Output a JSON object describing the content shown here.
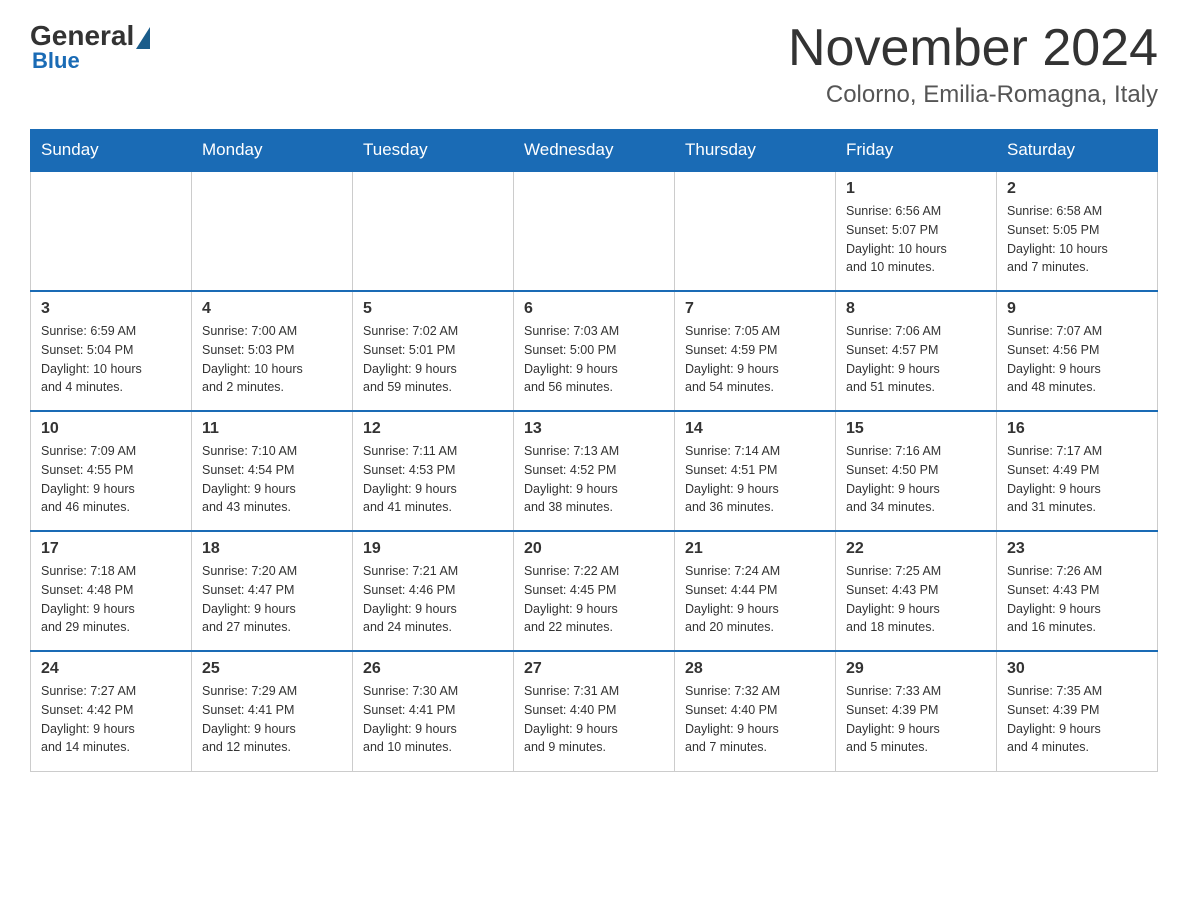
{
  "logo": {
    "general": "General",
    "blue": "Blue"
  },
  "title": "November 2024",
  "location": "Colorno, Emilia-Romagna, Italy",
  "days_of_week": [
    "Sunday",
    "Monday",
    "Tuesday",
    "Wednesday",
    "Thursday",
    "Friday",
    "Saturday"
  ],
  "weeks": [
    [
      {
        "day": "",
        "info": ""
      },
      {
        "day": "",
        "info": ""
      },
      {
        "day": "",
        "info": ""
      },
      {
        "day": "",
        "info": ""
      },
      {
        "day": "",
        "info": ""
      },
      {
        "day": "1",
        "info": "Sunrise: 6:56 AM\nSunset: 5:07 PM\nDaylight: 10 hours\nand 10 minutes."
      },
      {
        "day": "2",
        "info": "Sunrise: 6:58 AM\nSunset: 5:05 PM\nDaylight: 10 hours\nand 7 minutes."
      }
    ],
    [
      {
        "day": "3",
        "info": "Sunrise: 6:59 AM\nSunset: 5:04 PM\nDaylight: 10 hours\nand 4 minutes."
      },
      {
        "day": "4",
        "info": "Sunrise: 7:00 AM\nSunset: 5:03 PM\nDaylight: 10 hours\nand 2 minutes."
      },
      {
        "day": "5",
        "info": "Sunrise: 7:02 AM\nSunset: 5:01 PM\nDaylight: 9 hours\nand 59 minutes."
      },
      {
        "day": "6",
        "info": "Sunrise: 7:03 AM\nSunset: 5:00 PM\nDaylight: 9 hours\nand 56 minutes."
      },
      {
        "day": "7",
        "info": "Sunrise: 7:05 AM\nSunset: 4:59 PM\nDaylight: 9 hours\nand 54 minutes."
      },
      {
        "day": "8",
        "info": "Sunrise: 7:06 AM\nSunset: 4:57 PM\nDaylight: 9 hours\nand 51 minutes."
      },
      {
        "day": "9",
        "info": "Sunrise: 7:07 AM\nSunset: 4:56 PM\nDaylight: 9 hours\nand 48 minutes."
      }
    ],
    [
      {
        "day": "10",
        "info": "Sunrise: 7:09 AM\nSunset: 4:55 PM\nDaylight: 9 hours\nand 46 minutes."
      },
      {
        "day": "11",
        "info": "Sunrise: 7:10 AM\nSunset: 4:54 PM\nDaylight: 9 hours\nand 43 minutes."
      },
      {
        "day": "12",
        "info": "Sunrise: 7:11 AM\nSunset: 4:53 PM\nDaylight: 9 hours\nand 41 minutes."
      },
      {
        "day": "13",
        "info": "Sunrise: 7:13 AM\nSunset: 4:52 PM\nDaylight: 9 hours\nand 38 minutes."
      },
      {
        "day": "14",
        "info": "Sunrise: 7:14 AM\nSunset: 4:51 PM\nDaylight: 9 hours\nand 36 minutes."
      },
      {
        "day": "15",
        "info": "Sunrise: 7:16 AM\nSunset: 4:50 PM\nDaylight: 9 hours\nand 34 minutes."
      },
      {
        "day": "16",
        "info": "Sunrise: 7:17 AM\nSunset: 4:49 PM\nDaylight: 9 hours\nand 31 minutes."
      }
    ],
    [
      {
        "day": "17",
        "info": "Sunrise: 7:18 AM\nSunset: 4:48 PM\nDaylight: 9 hours\nand 29 minutes."
      },
      {
        "day": "18",
        "info": "Sunrise: 7:20 AM\nSunset: 4:47 PM\nDaylight: 9 hours\nand 27 minutes."
      },
      {
        "day": "19",
        "info": "Sunrise: 7:21 AM\nSunset: 4:46 PM\nDaylight: 9 hours\nand 24 minutes."
      },
      {
        "day": "20",
        "info": "Sunrise: 7:22 AM\nSunset: 4:45 PM\nDaylight: 9 hours\nand 22 minutes."
      },
      {
        "day": "21",
        "info": "Sunrise: 7:24 AM\nSunset: 4:44 PM\nDaylight: 9 hours\nand 20 minutes."
      },
      {
        "day": "22",
        "info": "Sunrise: 7:25 AM\nSunset: 4:43 PM\nDaylight: 9 hours\nand 18 minutes."
      },
      {
        "day": "23",
        "info": "Sunrise: 7:26 AM\nSunset: 4:43 PM\nDaylight: 9 hours\nand 16 minutes."
      }
    ],
    [
      {
        "day": "24",
        "info": "Sunrise: 7:27 AM\nSunset: 4:42 PM\nDaylight: 9 hours\nand 14 minutes."
      },
      {
        "day": "25",
        "info": "Sunrise: 7:29 AM\nSunset: 4:41 PM\nDaylight: 9 hours\nand 12 minutes."
      },
      {
        "day": "26",
        "info": "Sunrise: 7:30 AM\nSunset: 4:41 PM\nDaylight: 9 hours\nand 10 minutes."
      },
      {
        "day": "27",
        "info": "Sunrise: 7:31 AM\nSunset: 4:40 PM\nDaylight: 9 hours\nand 9 minutes."
      },
      {
        "day": "28",
        "info": "Sunrise: 7:32 AM\nSunset: 4:40 PM\nDaylight: 9 hours\nand 7 minutes."
      },
      {
        "day": "29",
        "info": "Sunrise: 7:33 AM\nSunset: 4:39 PM\nDaylight: 9 hours\nand 5 minutes."
      },
      {
        "day": "30",
        "info": "Sunrise: 7:35 AM\nSunset: 4:39 PM\nDaylight: 9 hours\nand 4 minutes."
      }
    ]
  ]
}
